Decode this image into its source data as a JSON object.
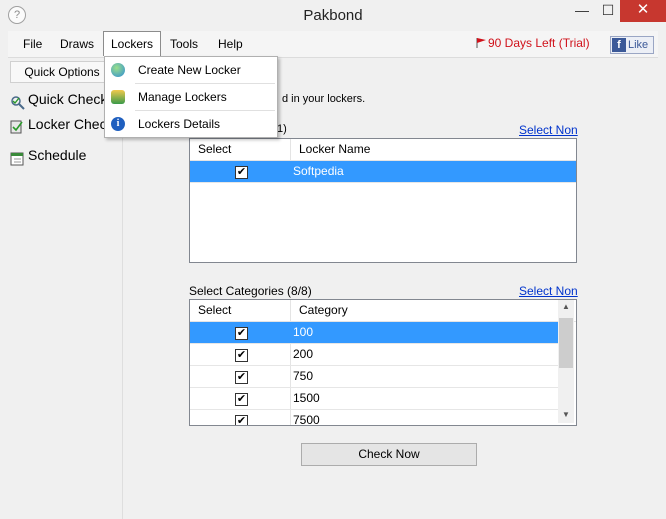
{
  "window": {
    "title": "Pakbond",
    "min": "—",
    "max": "☐",
    "close": "✕",
    "app_icon": "?"
  },
  "menubar": {
    "items": [
      "File",
      "Draws",
      "Lockers",
      "Tools",
      "Help"
    ],
    "trial": "90 Days Left (Trial)",
    "like": "Like"
  },
  "sidebar": {
    "quick_options": "Quick Options",
    "items": [
      "Quick Check",
      "Locker Check",
      "Schedule"
    ]
  },
  "lockers_menu": {
    "items": [
      "Create New Locker",
      "Manage Lockers",
      "Lockers Details"
    ]
  },
  "main": {
    "hint_text": "d in your lockers.",
    "lockers_count": "1)",
    "select_none": "Select Non",
    "lockers_grid": {
      "headers": [
        "Select",
        "Locker Name"
      ],
      "rows": [
        {
          "checked": "✔",
          "name": "Softpedia"
        }
      ]
    },
    "categories_label": "Select Categories (8/8)",
    "categories_grid": {
      "headers": [
        "Select",
        "Category"
      ],
      "rows": [
        {
          "checked": "✔",
          "name": "100"
        },
        {
          "checked": "✔",
          "name": "200"
        },
        {
          "checked": "✔",
          "name": "750"
        },
        {
          "checked": "✔",
          "name": "1500"
        },
        {
          "checked": "✔",
          "name": "7500"
        }
      ]
    },
    "check_now": "Check Now"
  },
  "colors": {
    "selection": "#3399ff",
    "trial_red": "#d0121b",
    "link_blue": "#0033cc",
    "close_red": "#c7372f"
  }
}
